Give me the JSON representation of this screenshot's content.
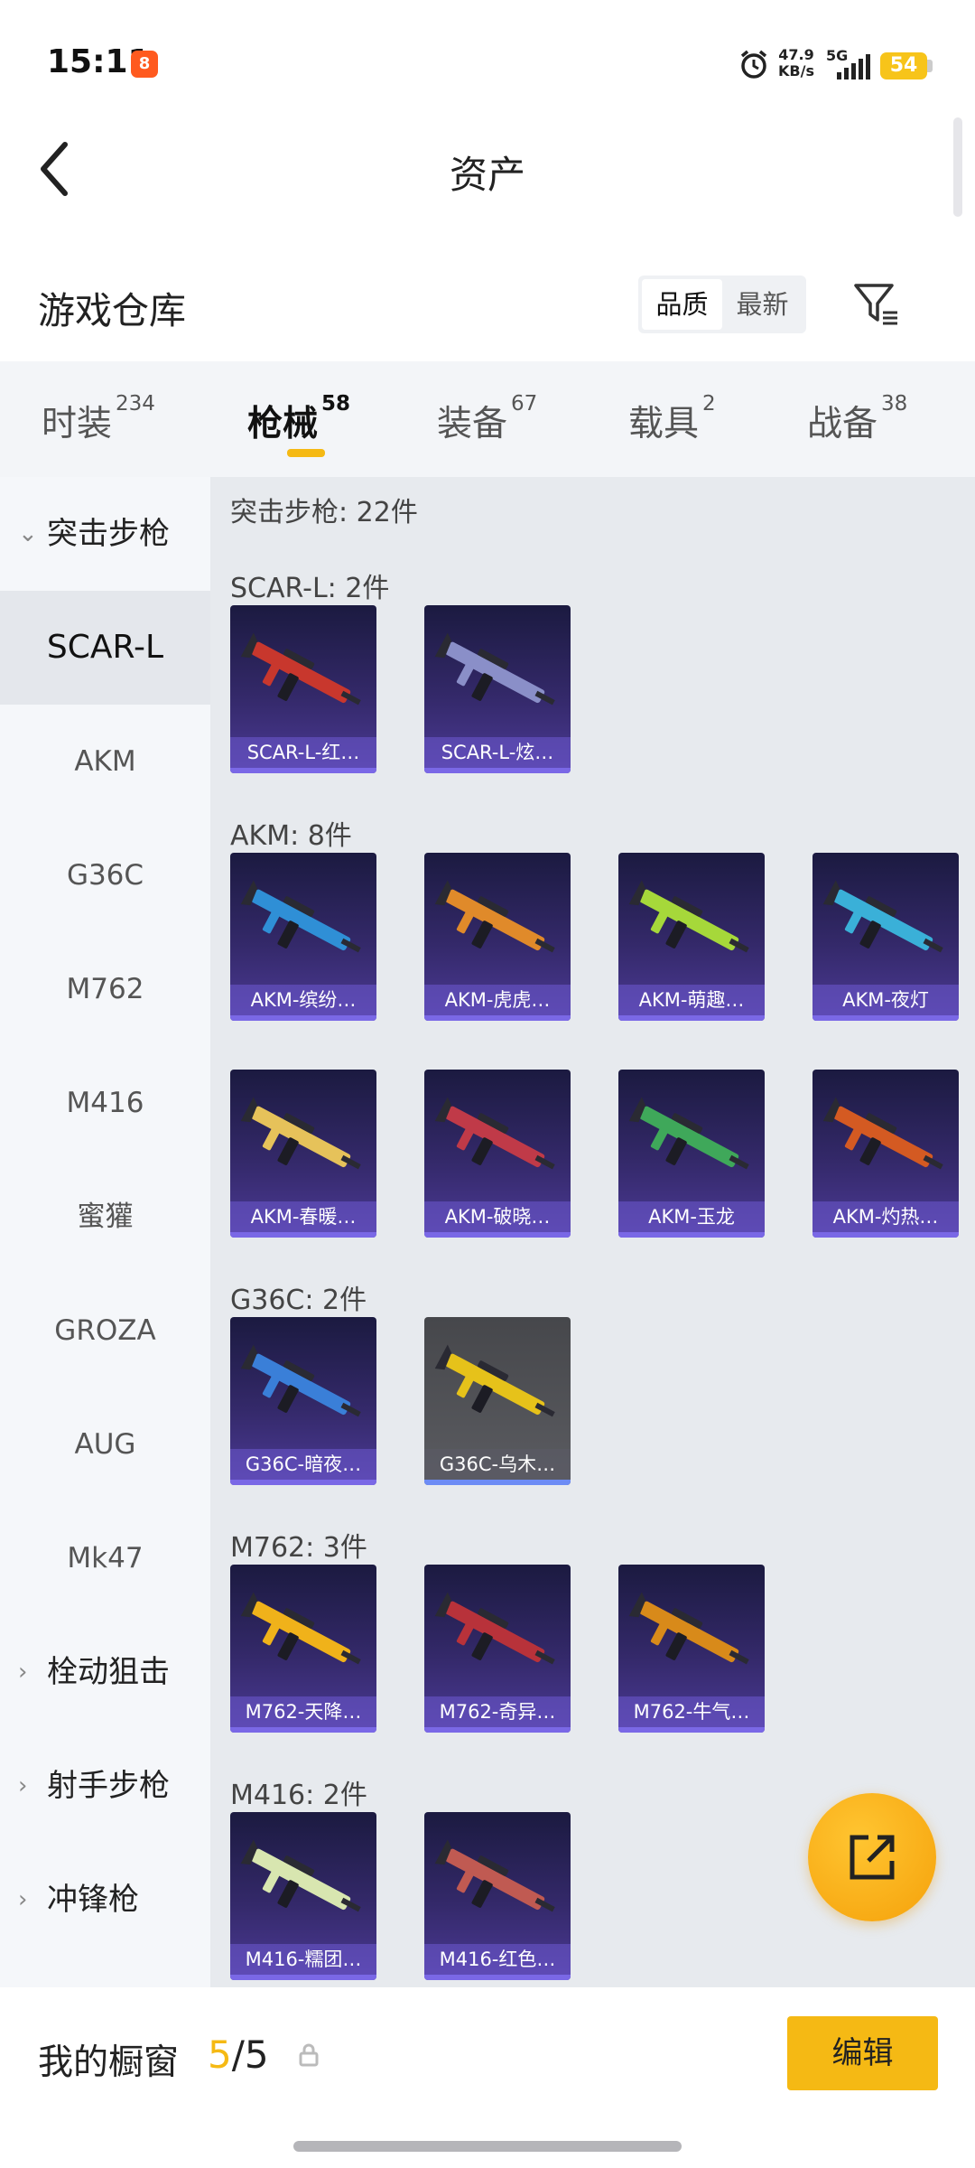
{
  "status_bar": {
    "time": "15:11",
    "app_badge": "8",
    "speed_value": "47.9",
    "speed_unit": "KB/s",
    "network": "5G",
    "battery": "54"
  },
  "header": {
    "title": "资产"
  },
  "warehouse": {
    "title": "游戏仓库",
    "sort_options": [
      "品质",
      "最新"
    ]
  },
  "tabs": [
    {
      "label": "时装",
      "count": "234"
    },
    {
      "label": "枪械",
      "count": "58"
    },
    {
      "label": "装备",
      "count": "67"
    },
    {
      "label": "载具",
      "count": "2"
    },
    {
      "label": "战备",
      "count": "38"
    }
  ],
  "sidebar": [
    {
      "label": "突击步枪",
      "type": "group"
    },
    {
      "label": "SCAR-L",
      "type": "item"
    },
    {
      "label": "AKM",
      "type": "item"
    },
    {
      "label": "G36C",
      "type": "item"
    },
    {
      "label": "M762",
      "type": "item"
    },
    {
      "label": "M416",
      "type": "item"
    },
    {
      "label": "蜜獾",
      "type": "item"
    },
    {
      "label": "GROZA",
      "type": "item"
    },
    {
      "label": "AUG",
      "type": "item"
    },
    {
      "label": "Mk47",
      "type": "item"
    },
    {
      "label": "栓动狙击",
      "type": "group"
    },
    {
      "label": "射手步枪",
      "type": "group"
    },
    {
      "label": "冲锋枪",
      "type": "group"
    }
  ],
  "content": {
    "total_label": "突击步枪: 22件",
    "sections": [
      {
        "label": "SCAR-L: 2件",
        "items": [
          {
            "name": "SCAR-L-红…",
            "color": "#c8372d"
          },
          {
            "name": "SCAR-L-炫…",
            "color": "#8a8fc8"
          }
        ]
      },
      {
        "label": "AKM: 8件",
        "items": [
          {
            "name": "AKM-缤纷…",
            "color": "#2f8fd6"
          },
          {
            "name": "AKM-虎虎…",
            "color": "#e08a2a"
          },
          {
            "name": "AKM-萌趣…",
            "color": "#a6d83a"
          },
          {
            "name": "AKM-夜灯",
            "color": "#3ab0d8"
          },
          {
            "name": "AKM-春暖…",
            "color": "#e6c25a"
          },
          {
            "name": "AKM-破晓…",
            "color": "#c03a48"
          },
          {
            "name": "AKM-玉龙",
            "color": "#3fa85a"
          },
          {
            "name": "AKM-灼热…",
            "color": "#d45a22"
          }
        ]
      },
      {
        "label": "G36C: 2件",
        "items": [
          {
            "name": "G36C-暗夜…",
            "color": "#3a7fd8"
          },
          {
            "name": "G36C-乌木…",
            "color": "#e6c21a",
            "style": "gray"
          }
        ]
      },
      {
        "label": "M762: 3件",
        "items": [
          {
            "name": "M762-天降…",
            "color": "#f0b21a"
          },
          {
            "name": "M762-奇异…",
            "color": "#b8323a"
          },
          {
            "name": "M762-牛气…",
            "color": "#d88a1a"
          }
        ]
      },
      {
        "label": "M416: 2件",
        "items": [
          {
            "name": "M416-糯团…",
            "color": "#d8e6b0"
          },
          {
            "name": "M416-红色…",
            "color": "#c05a52"
          }
        ]
      }
    ]
  },
  "bottom": {
    "label": "我的橱窗",
    "current": "5",
    "total": "/5",
    "edit_label": "编辑"
  }
}
